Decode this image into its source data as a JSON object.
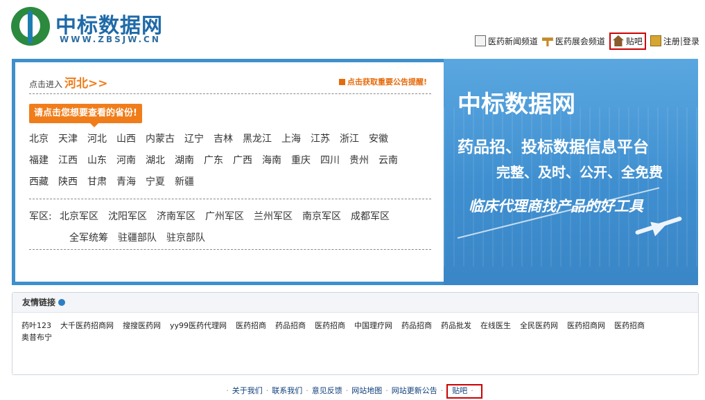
{
  "header": {
    "logo_title": "中标数据网",
    "logo_url": "WWW.ZBSJW.CN",
    "nav": [
      {
        "label": "医药新闻频道",
        "icon": "newspaper-icon"
      },
      {
        "label": "医药展会频道",
        "icon": "signpost-icon"
      },
      {
        "label": "贴吧",
        "icon": "home-icon"
      }
    ],
    "register": "注册",
    "separator": "|",
    "login": "登录"
  },
  "province_panel": {
    "enter_prefix": "点击进入",
    "current_province": "河北>>",
    "notice": "点击获取重要公告提醒!",
    "tip": "请点击您想要查看的省份!",
    "rows": [
      [
        "北京",
        "天津",
        "河北",
        "山西",
        "内蒙古",
        "辽宁",
        "吉林",
        "黑龙江",
        "上海",
        "江苏",
        "浙江",
        "安徽"
      ],
      [
        "福建",
        "江西",
        "山东",
        "河南",
        "湖北",
        "湖南",
        "广东",
        "广西",
        "海南",
        "重庆",
        "四川",
        "贵州",
        "云南"
      ],
      [
        "西藏",
        "陕西",
        "甘肃",
        "青海",
        "宁夏",
        "新疆"
      ]
    ],
    "military_label": "军区:",
    "military_row1": [
      "北京军区",
      "沈阳军区",
      "济南军区",
      "广州军区",
      "兰州军区",
      "南京军区",
      "成都军区"
    ],
    "military_row2": [
      "全军统筹",
      "驻疆部队",
      "驻京部队"
    ]
  },
  "banner": {
    "title": "中标数据网",
    "line1": "药品招、投标数据信息平台",
    "line2": "完整、及时、公开、全免费",
    "line3": "临床代理商找产品的好工具"
  },
  "friend_links": {
    "title": "友情链接",
    "items": [
      "药叶123",
      "大千医药招商网",
      "搜搜医药网",
      "yy99医药代理网",
      "医药招商",
      "药品招商",
      "医药招商",
      "中国理疗网",
      "药品招商",
      "药品批发",
      "在线医生",
      "全民医药网",
      "医药招商网",
      "医药招商",
      "奥昔布宁"
    ]
  },
  "footer": {
    "items": [
      "关于我们",
      "联系我们",
      "意见反馈",
      "网站地图",
      "网站更新公告"
    ],
    "tieba": "贴吧"
  }
}
